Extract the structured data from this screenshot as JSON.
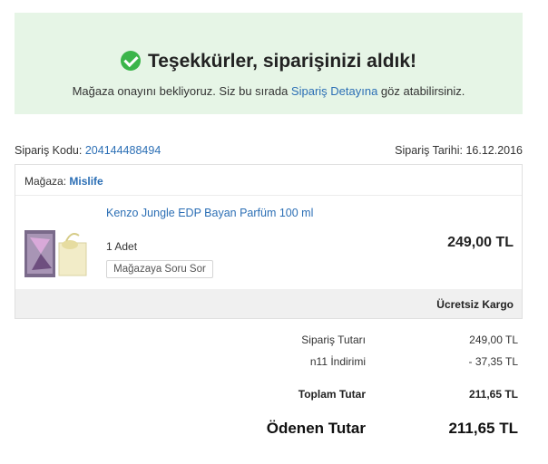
{
  "banner": {
    "title": "Teşekkürler, siparişinizi aldık!",
    "subtitle_before": "Mağaza onayını bekliyoruz. Siz bu sırada ",
    "subtitle_link": "Sipariş Detayına",
    "subtitle_after": " göz atabilirsiniz."
  },
  "order": {
    "code_label": "Sipariş Kodu:",
    "code_value": "204144488494",
    "date_label": "Sipariş Tarihi:",
    "date_value": "16.12.2016"
  },
  "store": {
    "label": "Mağaza:",
    "name": "Mislife"
  },
  "product": {
    "name": "Kenzo Jungle EDP Bayan Parfüm 100 ml",
    "quantity": "1 Adet",
    "ask_button": "Mağazaya Soru Sor",
    "price": "249,00 TL"
  },
  "shipping": "Ücretsiz Kargo",
  "summary": {
    "subtotal_label": "Sipariş Tutarı",
    "subtotal_value": "249,00 TL",
    "discount_label": "n11 İndirimi",
    "discount_value": "- 37,35 TL",
    "total_label": "Toplam Tutar",
    "total_value": "211,65 TL",
    "paid_label": "Ödenen Tutar",
    "paid_value": "211,65 TL"
  },
  "colors": {
    "accent": "#2c6fb5",
    "success": "#3bb54a",
    "banner_bg": "#e6f5e6"
  }
}
